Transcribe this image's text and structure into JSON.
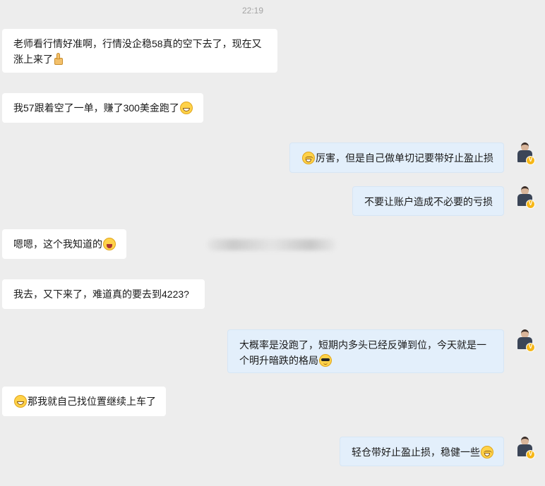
{
  "timestamp": "22:19",
  "messages": [
    {
      "side": "left",
      "text": "老师看行情好准啊，行情没企稳58真的空下去了，现在又涨上来了",
      "emoji": "thumbs-up-icon"
    },
    {
      "side": "left",
      "text": "我57跟着空了一单，赚了300美金跑了",
      "emoji": "grin-emoji-icon"
    },
    {
      "side": "right",
      "text": "厉害，但是自己做单切记要带好止盈止损",
      "emoji": "tears-of-joy-emoji-icon"
    },
    {
      "side": "right",
      "text": "不要让账户造成不必要的亏损"
    },
    {
      "side": "left",
      "text": "嗯嗯，这个我知道的",
      "emoji": "laugh-emoji-icon"
    },
    {
      "side": "left",
      "text": "我去，又下来了，难道真的要去到4223?"
    },
    {
      "side": "right",
      "text": "大概率是没跑了，短期内多头已经反弹到位，今天就是一个明升暗跌的格局",
      "emoji": "sunglasses-emoji-icon"
    },
    {
      "side": "left",
      "text": "那我就自己找位置继续上车了",
      "emoji": "grin-emoji-icon"
    },
    {
      "side": "right",
      "text": "轻仓带好止盈止损，稳健一些",
      "emoji": "tears-of-joy-emoji-icon"
    }
  ],
  "badge_mark": "V",
  "colors": {
    "background": "#ededed",
    "left_bubble": "#ffffff",
    "right_bubble": "#e3effb",
    "timestamp": "#a4a4a4"
  }
}
